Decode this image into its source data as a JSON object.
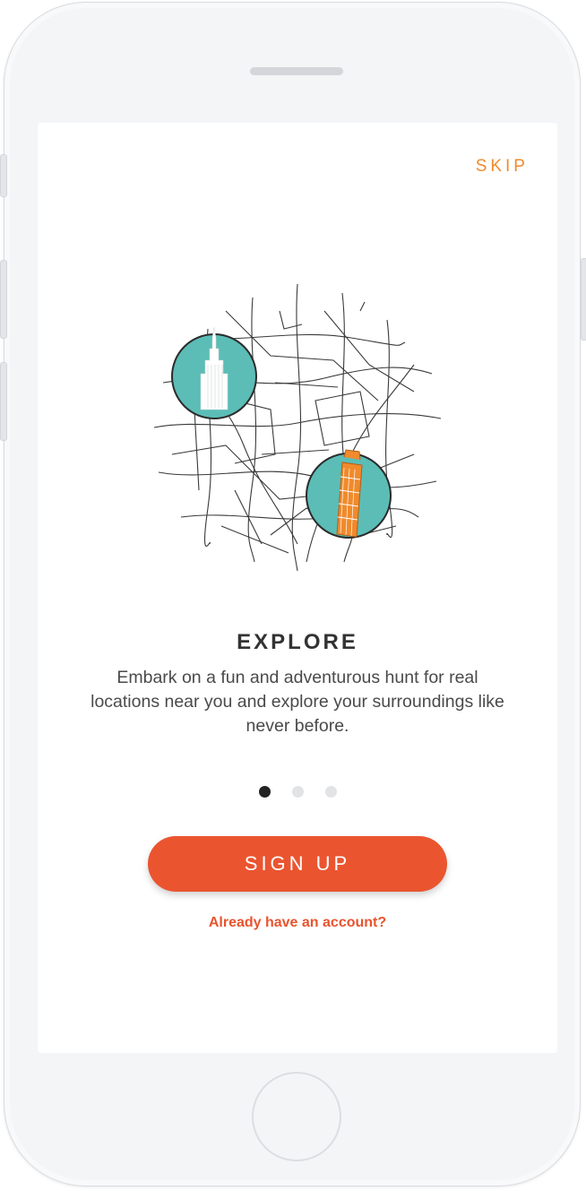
{
  "header": {
    "skip_label": "SKIP"
  },
  "illustration": {
    "map_icon": "city-map-icon",
    "landmark_1_icon": "empire-state-building-icon",
    "landmark_2_icon": "leaning-tower-of-pisa-icon",
    "colors": {
      "teal": "#5bbdb6",
      "orange": "#f08a2c",
      "road": "#3a3a3a"
    }
  },
  "onboarding": {
    "title": "EXPLORE",
    "description": "Embark on a fun and adventurous hunt for real locations near you and explore your surroundings like never before.",
    "page_index": 1,
    "page_count": 3
  },
  "actions": {
    "signup_label": "SIGN UP",
    "login_link": "Already have an account?"
  },
  "colors": {
    "accent": "#ea5530",
    "skip": "#f08a2c"
  }
}
